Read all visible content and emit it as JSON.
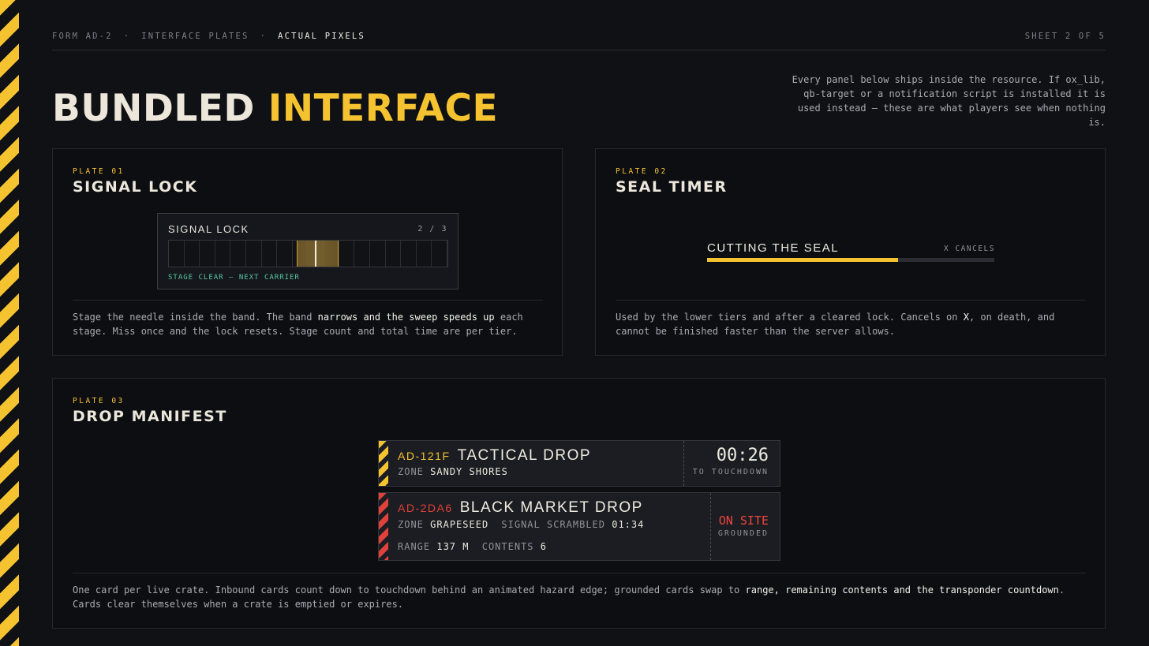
{
  "header": {
    "crumbs": [
      "FORM AD-2",
      "INTERFACE PLATES",
      "ACTUAL PIXELS"
    ],
    "separator": "·",
    "sheet": "SHEET 2 OF 5"
  },
  "title": {
    "part1": "BUNDLED",
    "part2": "INTERFACE"
  },
  "intro": "Every panel below ships inside the resource. If ox_lib, qb-target or a notification script is installed it is used instead — these are what players see when nothing is.",
  "plates": [
    {
      "number": "PLATE 01",
      "name": "SIGNAL LOCK",
      "desc_a": "Stage the needle inside the band. The band ",
      "desc_hl": "narrows and the sweep speeds up",
      "desc_b": " each stage. Miss once and the lock resets. Stage count and total time are per tier."
    },
    {
      "number": "PLATE 02",
      "name": "SEAL TIMER",
      "desc_a": "Used by the lower tiers and after a cleared lock. Cancels on ",
      "desc_hl": "X",
      "desc_b": ", on death, and cannot be finished faster than the server allows."
    },
    {
      "number": "PLATE 03",
      "name": "DROP MANIFEST",
      "desc_a": "One card per live crate. Inbound cards count down to touchdown behind an animated hazard edge; grounded cards swap to ",
      "desc_hl": "range, remaining contents and the transponder countdown",
      "desc_b": ". Cards clear themselves when a crate is emptied or expires."
    }
  ],
  "signal_lock": {
    "title": "SIGNAL LOCK",
    "count": "2 / 3",
    "status": "STAGE CLEAR — NEXT CARRIER",
    "segments": 18
  },
  "seal_timer": {
    "label": "CUTTING THE SEAL",
    "cancel": "X CANCELS",
    "progress": 0.665
  },
  "drops": [
    {
      "id": "AD-121F",
      "name": "TACTICAL DROP",
      "zone_label": "ZONE",
      "zone": "SANDY SHORES",
      "timer": "00:26",
      "timer_sub": "TO TOUCHDOWN",
      "accent": "#f5c230"
    },
    {
      "id": "AD-2DA6",
      "name": "BLACK MARKET DROP",
      "zone_label": "ZONE",
      "zone": "GRAPESEED",
      "scrambled_label": "SIGNAL SCRAMBLED",
      "scrambled": "01:34",
      "range_label": "RANGE",
      "range": "137 M",
      "contents_label": "CONTENTS",
      "contents": "6",
      "status": "ON SITE",
      "status_sub": "GROUNDED",
      "accent": "#e0413a"
    }
  ],
  "colors": {
    "accent": "#f5c230",
    "alert": "#ec463d",
    "success": "#58c8a0",
    "background": "#0f1115"
  }
}
